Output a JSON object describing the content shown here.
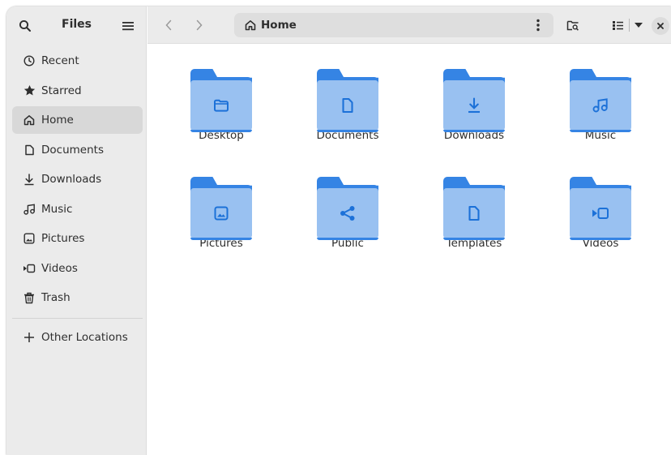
{
  "window": {
    "colors": {
      "accent": "#3584e4",
      "folder_front": "#99c1f1",
      "sidebar_bg": "#ebebeb",
      "active_bg": "#d8d8d8"
    }
  },
  "sidebar": {
    "title": "Files",
    "search_icon": "search-icon",
    "menu_icon": "hamburger-menu-icon",
    "items": [
      {
        "label": "Recent",
        "icon": "clock-icon",
        "active": false
      },
      {
        "label": "Starred",
        "icon": "star-icon",
        "active": false
      },
      {
        "label": "Home",
        "icon": "home-icon",
        "active": true
      },
      {
        "label": "Documents",
        "icon": "document-icon",
        "active": false
      },
      {
        "label": "Downloads",
        "icon": "download-icon",
        "active": false
      },
      {
        "label": "Music",
        "icon": "music-note-icon",
        "active": false
      },
      {
        "label": "Pictures",
        "icon": "picture-icon",
        "active": false
      },
      {
        "label": "Videos",
        "icon": "video-camera-icon",
        "active": false
      },
      {
        "label": "Trash",
        "icon": "trash-icon",
        "active": false
      }
    ],
    "other": {
      "label": "Other Locations",
      "icon": "plus-icon"
    }
  },
  "header": {
    "back_icon": "chevron-left-icon",
    "forward_icon": "chevron-right-icon",
    "path": {
      "label": "Home",
      "icon": "home-icon",
      "more_icon": "vertical-ellipsis-icon"
    },
    "search_icon": "folder-search-icon",
    "view_icon": "list-view-icon",
    "view_dropdown_icon": "triangle-down-icon",
    "close_icon": "close-icon"
  },
  "content": {
    "items": [
      {
        "label": "Desktop",
        "glyph": "desktop-folder-icon"
      },
      {
        "label": "Documents",
        "glyph": "document-icon"
      },
      {
        "label": "Downloads",
        "glyph": "download-icon"
      },
      {
        "label": "Music",
        "glyph": "music-note-icon"
      },
      {
        "label": "Pictures",
        "glyph": "picture-icon"
      },
      {
        "label": "Public",
        "glyph": "share-icon"
      },
      {
        "label": "Templates",
        "glyph": "template-icon"
      },
      {
        "label": "Videos",
        "glyph": "video-camera-icon"
      }
    ]
  }
}
